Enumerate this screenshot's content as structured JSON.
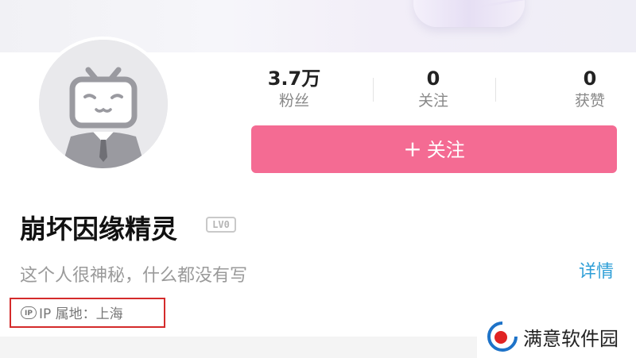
{
  "profile": {
    "username": "崩坏因缘精灵",
    "level_badge": "LV0",
    "bio": "这个人很神秘，什么都没有写",
    "details_link": "详情",
    "ip_location": "IP 属地：上海",
    "ip_icon": "IP"
  },
  "stats": [
    {
      "value": "3.7万",
      "label": "粉丝"
    },
    {
      "value": "0",
      "label": "关注"
    },
    {
      "value": "0",
      "label": "获赞"
    }
  ],
  "actions": {
    "follow_plus": "+",
    "follow_label": "关注"
  },
  "watermark": {
    "text": "满意软件园"
  },
  "colors": {
    "follow_button": "#f46b93",
    "link": "#2f9fd7",
    "highlight_box": "#d42b2b"
  },
  "icons": {
    "avatar": "bilibili-tv-mascot-icon",
    "ip": "ip-icon",
    "watermark_logo": "watermark-logo-icon"
  }
}
